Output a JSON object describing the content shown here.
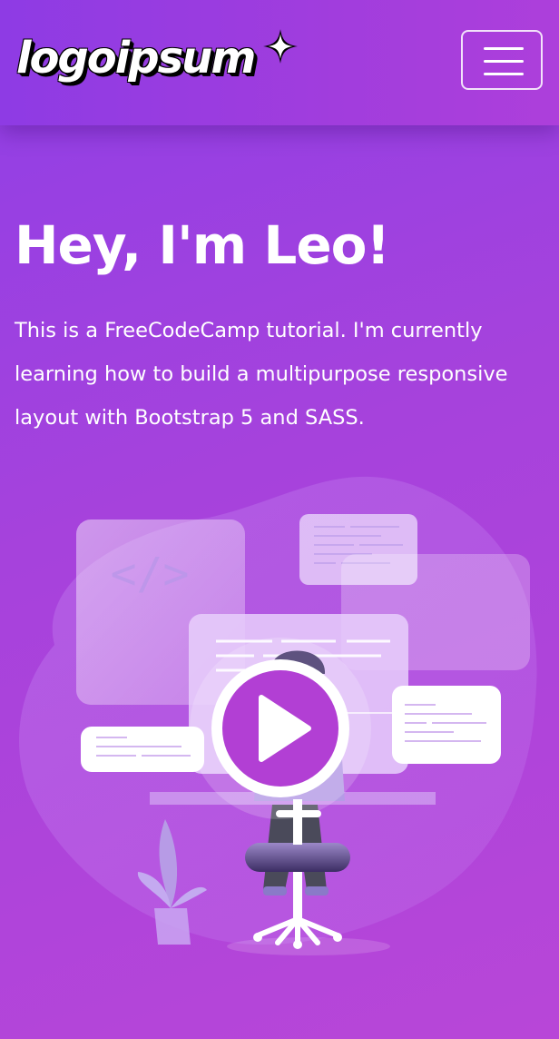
{
  "navbar": {
    "brand": "logoipsum",
    "toggler_icon": "hamburger-menu-icon"
  },
  "hero": {
    "title": "Hey, I'm Leo!",
    "description": "This is a FreeCodeCamp tutorial. I'm currently learning how to build a multipurpose responsive layout with Bootstrap 5 and SASS."
  },
  "illustration": {
    "code_symbol": "</>",
    "play_icon": "play-icon"
  },
  "colors": {
    "gradient_start": "#8f3fe6",
    "gradient_end": "#b846d8",
    "accent": "#b23fd4"
  }
}
